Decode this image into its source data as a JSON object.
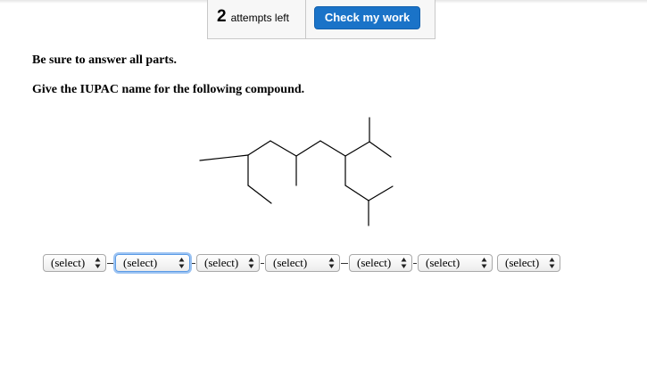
{
  "header": {
    "attempts_count": "2",
    "attempts_label": "attempts left",
    "check_button_label": "Check my work"
  },
  "content": {
    "instruction": "Be sure to answer all parts.",
    "question": "Give the IUPAC name for the following compound."
  },
  "answer": {
    "selects": [
      {
        "value": "(select)"
      },
      {
        "value": "(select)"
      },
      {
        "value": "(select)"
      },
      {
        "value": "(select)"
      },
      {
        "value": "(select)"
      },
      {
        "value": "(select)"
      },
      {
        "value": "(select)"
      }
    ],
    "separator": "-"
  },
  "colors": {
    "accent": "#1a73c8",
    "focus": "#5b9be6"
  }
}
